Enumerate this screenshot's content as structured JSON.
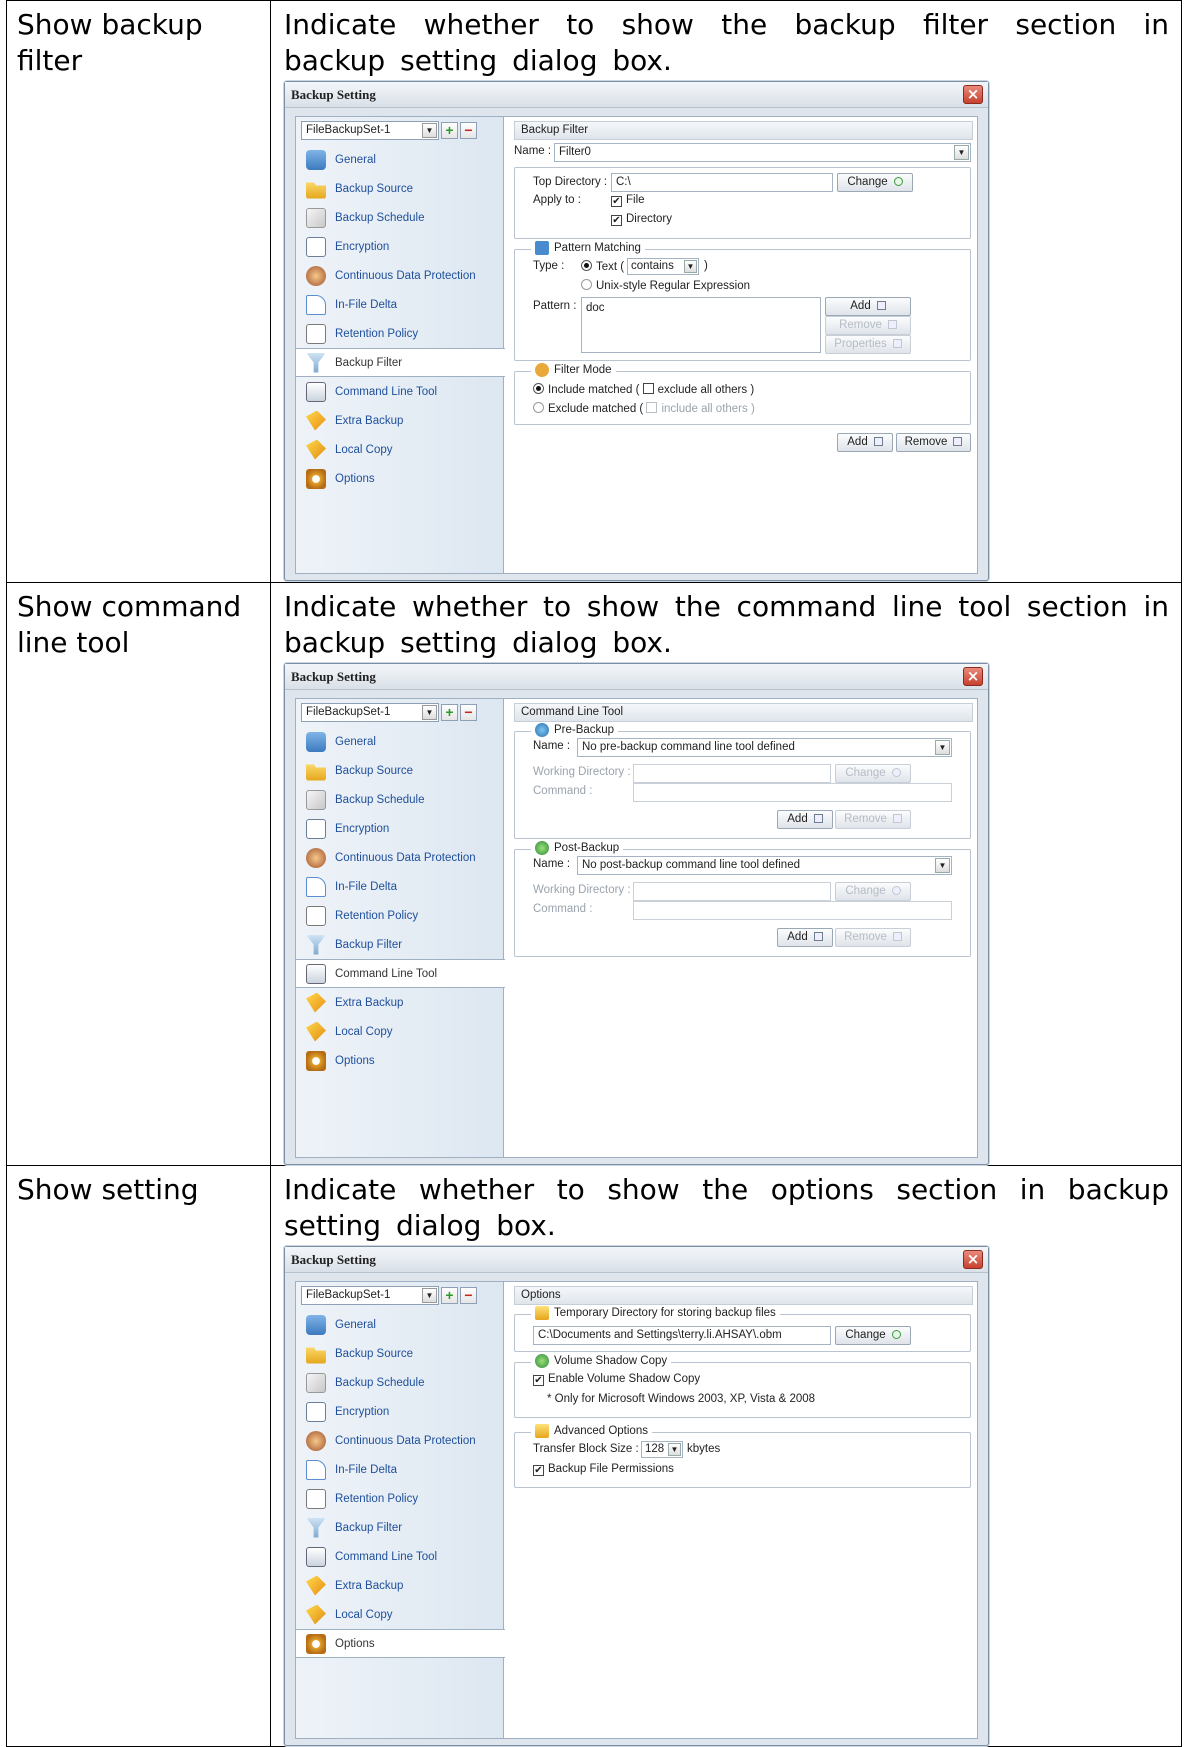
{
  "rows": [
    {
      "label": "Show backup filter",
      "description": "Indicate whether to show the backup filter section in backup setting dialog box."
    },
    {
      "label": "Show command line tool",
      "description": "Indicate whether to show the command line tool section in backup setting dialog box."
    },
    {
      "label": "Show setting",
      "description": "Indicate whether to show the options section in backup setting dialog box."
    }
  ],
  "dialog": {
    "title": "Backup Setting",
    "backup_set": "FileBackupSet-1",
    "nav": [
      "General",
      "Backup Source",
      "Backup Schedule",
      "Encryption",
      "Continuous Data Protection",
      "In-File Delta",
      "Retention Policy",
      "Backup Filter",
      "Command Line Tool",
      "Extra Backup",
      "Local Copy",
      "Options"
    ]
  },
  "filter_panel": {
    "header": "Backup Filter",
    "name_label": "Name :",
    "name_value": "Filter0",
    "top_dir_label": "Top Directory :",
    "top_dir_value": "C:\\",
    "change": "Change",
    "apply_to_label": "Apply to :",
    "apply_file": "File",
    "apply_dir": "Directory",
    "pattern_group": "Pattern Matching",
    "type_label": "Type :",
    "type_text_prefix": "Text (",
    "type_text_value": "contains",
    "type_text_suffix": ")",
    "type_unix": "Unix-style Regular Expression",
    "pattern_label": "Pattern :",
    "pattern_value": "doc",
    "add": "Add",
    "remove": "Remove",
    "properties": "Properties",
    "mode_group": "Filter Mode",
    "include_matched": "Include matched (",
    "exclude_all_others": "exclude all others )",
    "exclude_matched": "Exclude matched (",
    "include_all_others": "include all others )"
  },
  "cmd_panel": {
    "header": "Command Line Tool",
    "pre_group": "Pre-Backup",
    "post_group": "Post-Backup",
    "name_label": "Name :",
    "pre_name": "No pre-backup command line tool defined",
    "post_name": "No post-backup command line tool defined",
    "working_dir": "Working Directory :",
    "command": "Command :",
    "change": "Change",
    "add": "Add",
    "remove": "Remove"
  },
  "options_panel": {
    "header": "Options",
    "temp_group": "Temporary Directory for storing backup files",
    "temp_value": "C:\\Documents and Settings\\terry.li.AHSAY\\.obm",
    "change": "Change",
    "vss_group": "Volume Shadow Copy",
    "vss_enable": "Enable Volume Shadow Copy",
    "vss_note": "* Only for Microsoft Windows 2003, XP, Vista & 2008",
    "adv_group": "Advanced Options",
    "block_label": "Transfer Block Size :",
    "block_value": "128",
    "block_unit": "kbytes",
    "perm": "Backup File Permissions"
  },
  "colors": {
    "nav_link": "#1f4f9c",
    "close_red": "#c8412e",
    "panel_bg": "#dfe5ec"
  }
}
